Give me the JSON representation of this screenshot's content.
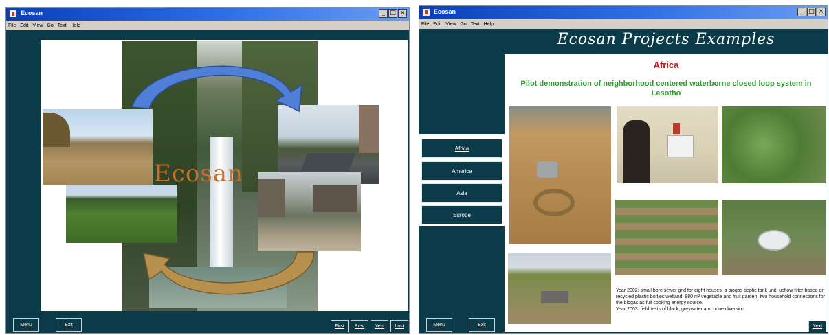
{
  "left_window": {
    "title": "Ecosan",
    "menu": [
      "File",
      "Edit",
      "View",
      "Go",
      "Text",
      "Help"
    ],
    "controls": [
      "_",
      "□",
      "×"
    ],
    "center_text": "Ecosan",
    "buttons": {
      "menu": "Menu",
      "exit": "Exit",
      "first": "First",
      "prev": "Prev",
      "next": "Next",
      "last": "Last"
    }
  },
  "right_window": {
    "title": "Ecosan",
    "menu": [
      "File",
      "Edit",
      "View",
      "Go",
      "Text",
      "Help"
    ],
    "controls": [
      "_",
      "□",
      "×"
    ],
    "heading": "Ecosan Projects Examples",
    "region": "Africa",
    "subtitle": "Pilot demonstration of neighborhood centered waterborne closed loop system in Lesotho",
    "nav": [
      "Africa",
      "America",
      "Asia",
      "Europe"
    ],
    "description": "Year 2002: small bore sewer grid for eight houses, a biogas-septic tank unit, upflow filter based on recycled plastic bottles,wetland, 880 m² vegetable and fruit garden, two household connections for the biogas as full cooking energy source.",
    "description2": "Year 2003: field tests of black, greywater and urine diversion",
    "buttons": {
      "menu": "Menu",
      "exit": "Exit",
      "next": "Next"
    }
  },
  "colors": {
    "panel": "#0b3b48",
    "titlebar": "#2f6fe6",
    "region": "#c0181e",
    "subtitle": "#2a9a2a",
    "arrow_blue": "#4f7fd6",
    "arrow_tan": "#b8904e",
    "ecosan_text": "#c8702a"
  }
}
